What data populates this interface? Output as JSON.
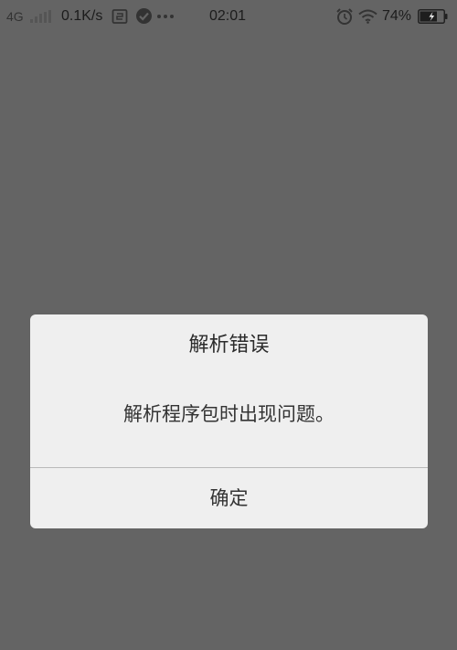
{
  "status_bar": {
    "network_type": "4G",
    "net_speed": "0.1K/s",
    "time": "02:01",
    "battery_percent": "74%",
    "battery_level": 0.74,
    "icons": [
      "signal-icon",
      "notification-icon",
      "check-circle-icon",
      "more-icon",
      "alarm-icon",
      "wifi-icon",
      "battery-charging-icon"
    ]
  },
  "dialog": {
    "title": "解析错误",
    "message": "解析程序包时出现问题。",
    "confirm_label": "确定"
  },
  "colors": {
    "overlay": "#646464",
    "dialog_bg": "#efefef",
    "divider": "#b9b9b9",
    "text": "#333333"
  }
}
